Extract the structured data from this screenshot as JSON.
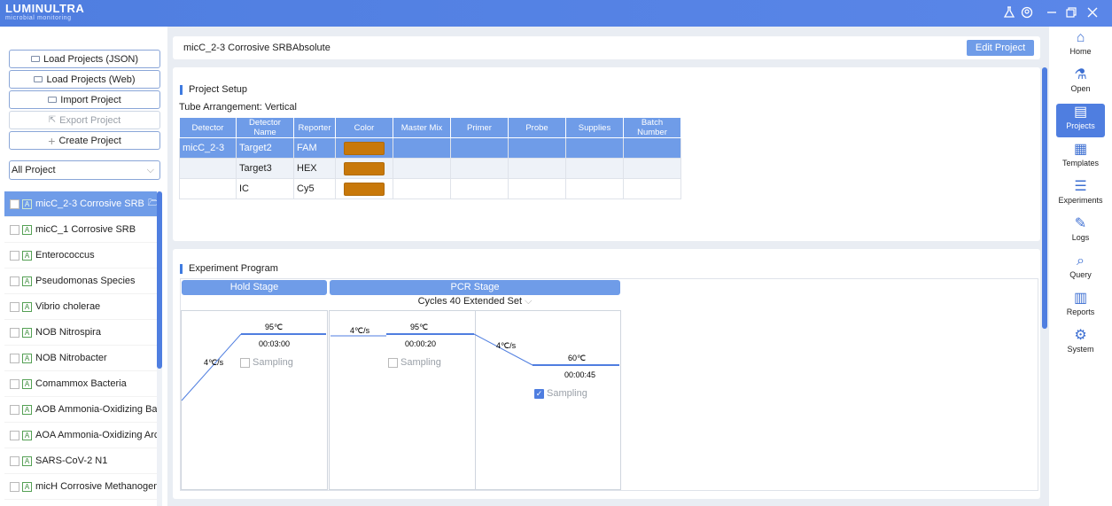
{
  "app": {
    "brand": "LUMINULTRA",
    "tagline": "microbial monitoring"
  },
  "left": {
    "buttons": [
      "Load Projects (JSON)",
      "Load Projects (Web)",
      "Import Project",
      "Export Project",
      "Create Project"
    ],
    "filter": "All Project",
    "projects": [
      "micC_2-3 Corrosive SRB",
      "micC_1 Corrosive SRB",
      "Enterococcus",
      "Pseudomonas Species",
      "Vibrio cholerae",
      "NOB Nitrospira",
      "NOB Nitrobacter",
      "Comammox Bacteria",
      "AOB Ammonia-Oxidizing Bact..",
      "AOA Ammonia-Oxidizing Arc...",
      "SARS-CoV-2 N1",
      "micH Corrosive Methanogens"
    ],
    "badge": "A"
  },
  "header": {
    "project": "micC_2-3 Corrosive SRB",
    "mode": "Absolute",
    "edit": "Edit Project"
  },
  "setup": {
    "title": "Project Setup",
    "arrangement_label": "Tube Arrangement:",
    "arrangement_value": "Vertical",
    "columns": [
      "Detector",
      "Detector Name",
      "Reporter",
      "Color",
      "Master Mix",
      "Primer",
      "Probe",
      "Supplies",
      "Batch Number"
    ],
    "rows": [
      {
        "detector": "micC_2-3",
        "name": "Target2",
        "reporter": "FAM"
      },
      {
        "detector": "",
        "name": "Target3",
        "reporter": "HEX"
      },
      {
        "detector": "",
        "name": "IC",
        "reporter": "Cy5"
      }
    ],
    "swatch_color": "#c8780a"
  },
  "program": {
    "title": "Experiment Program",
    "hold": {
      "title": "Hold Stage",
      "rate": "4℃/s",
      "temp": "95℃",
      "time": "00:03:00",
      "sampling": "Sampling"
    },
    "pcr": {
      "title": "PCR Stage",
      "cycles_label": "Cycles",
      "cycles": "40",
      "extended": "Extended Set",
      "step1": {
        "rate": "4℃/s",
        "temp": "95℃",
        "time": "00:00:20",
        "sampling": "Sampling"
      },
      "step2": {
        "rate": "4℃/s",
        "temp": "60℃",
        "time": "00:00:45",
        "sampling": "Sampling"
      }
    }
  },
  "nav": [
    "Home",
    "Open",
    "Projects",
    "Templates",
    "Experiments",
    "Logs",
    "Query",
    "Reports",
    "System"
  ],
  "colors": {
    "accent": "#4f7ee0",
    "selected": "#6f9ce8",
    "swatch": "#c8780a"
  }
}
